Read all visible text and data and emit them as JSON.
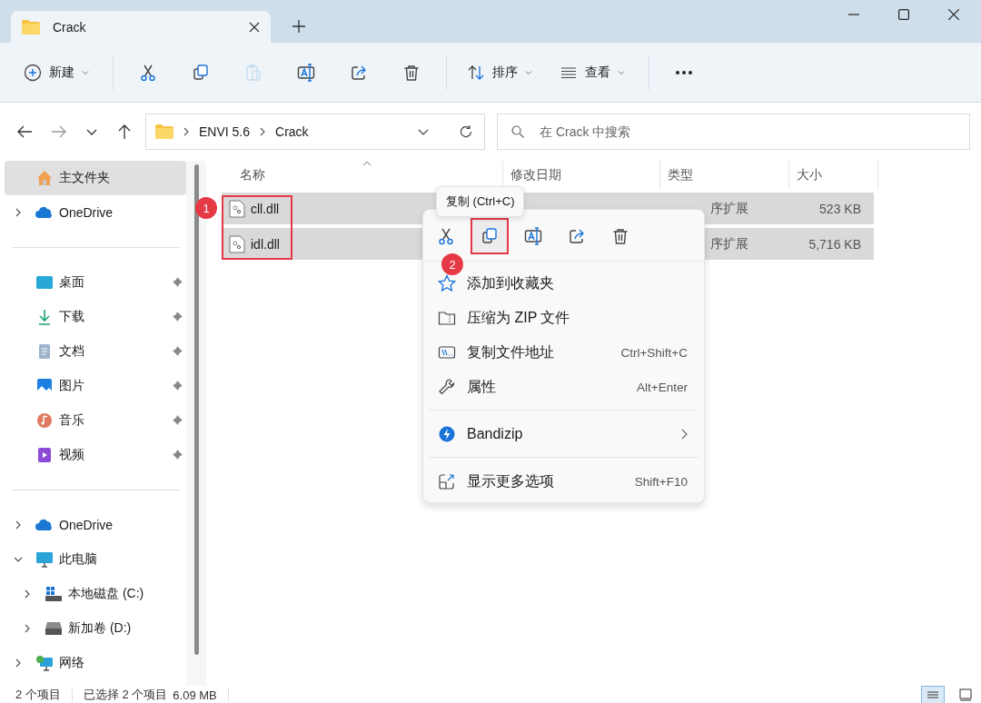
{
  "tabs": [
    {
      "title": "Crack",
      "selected": true
    }
  ],
  "toolbar": {
    "new_label": "新建",
    "sort_label": "排序",
    "view_label": "查看",
    "actions": [
      {
        "kind": "cut",
        "disabled": false
      },
      {
        "kind": "copy",
        "disabled": false
      },
      {
        "kind": "paste",
        "disabled": true
      },
      {
        "kind": "rename",
        "disabled": false
      },
      {
        "kind": "share",
        "disabled": false
      },
      {
        "kind": "delete",
        "disabled": false
      }
    ]
  },
  "breadcrumb": [
    "ENVI 5.6",
    "Crack"
  ],
  "search": {
    "placeholder": "在 Crack 中搜索"
  },
  "sidebar": [
    {
      "kind": "home",
      "label": "主文件夹",
      "selected": true
    },
    {
      "kind": "cloud",
      "label": "OneDrive",
      "selected": false,
      "expanded": false
    },
    {
      "kind": "divider"
    },
    {
      "kind": "desktop",
      "label": "桌面",
      "selected": false,
      "pinned": true
    },
    {
      "kind": "download",
      "label": "下载",
      "selected": false,
      "pinned": true
    },
    {
      "kind": "document",
      "label": "文档",
      "selected": false,
      "pinned": true
    },
    {
      "kind": "picture",
      "label": "图片",
      "selected": false,
      "pinned": true
    },
    {
      "kind": "music",
      "label": "音乐",
      "selected": false,
      "pinned": true
    },
    {
      "kind": "video",
      "label": "视频",
      "selected": false,
      "pinned": true
    },
    {
      "kind": "divider"
    },
    {
      "kind": "cloud",
      "label": "OneDrive",
      "selected": false,
      "expanded": false
    },
    {
      "kind": "computer",
      "label": "此电脑",
      "selected": false,
      "expanded": true,
      "children": [
        {
          "kind": "system-drive",
          "label": "本地磁盘 (C:)",
          "selected": false,
          "expanded": false
        },
        {
          "kind": "drive",
          "label": "新加卷 (D:)",
          "selected": false,
          "expanded": false
        }
      ]
    },
    {
      "kind": "network",
      "label": "网络",
      "selected": false,
      "expanded": false
    }
  ],
  "columns": [
    {
      "label": "名称",
      "sorted": true
    },
    {
      "label": "修改日期",
      "sorted": false
    },
    {
      "label": "类型",
      "sorted": false
    },
    {
      "label": "大小",
      "sorted": false
    }
  ],
  "files": [
    {
      "name": "cll.dll",
      "type": "序扩展",
      "size": "523 KB",
      "selected": true
    },
    {
      "name": "idl.dll",
      "type": "序扩展",
      "size": "5,716 KB",
      "selected": true
    }
  ],
  "file_names_outlined": true,
  "tooltip": "复制 (Ctrl+C)",
  "context_menu": {
    "actions": [
      {
        "kind": "cut",
        "outlined": false
      },
      {
        "kind": "copy",
        "outlined": true
      },
      {
        "kind": "rename",
        "outlined": false
      },
      {
        "kind": "share",
        "outlined": false
      },
      {
        "kind": "delete",
        "outlined": false
      }
    ],
    "items": [
      {
        "kind": "star",
        "label": "添加到收藏夹"
      },
      {
        "kind": "zip",
        "label": "压缩为 ZIP 文件"
      },
      {
        "kind": "path",
        "label": "复制文件地址",
        "shortcut": "Ctrl+Shift+C"
      },
      {
        "kind": "wrench",
        "label": "属性",
        "shortcut": "Alt+Enter"
      },
      {
        "kind": "separator"
      },
      {
        "kind": "bandizip",
        "label": "Bandizip",
        "submenu": true
      },
      {
        "kind": "separator"
      },
      {
        "kind": "more",
        "label": "显示更多选项",
        "shortcut": "Shift+F10"
      }
    ]
  },
  "callouts": [
    "1",
    "2"
  ],
  "status_bar": {
    "count": "2 个项目",
    "selection": "已选择 2 个项目",
    "size": "6.09 MB"
  },
  "view_modes": [
    {
      "kind": "details",
      "selected": true
    },
    {
      "kind": "tiles",
      "selected": false
    }
  ]
}
